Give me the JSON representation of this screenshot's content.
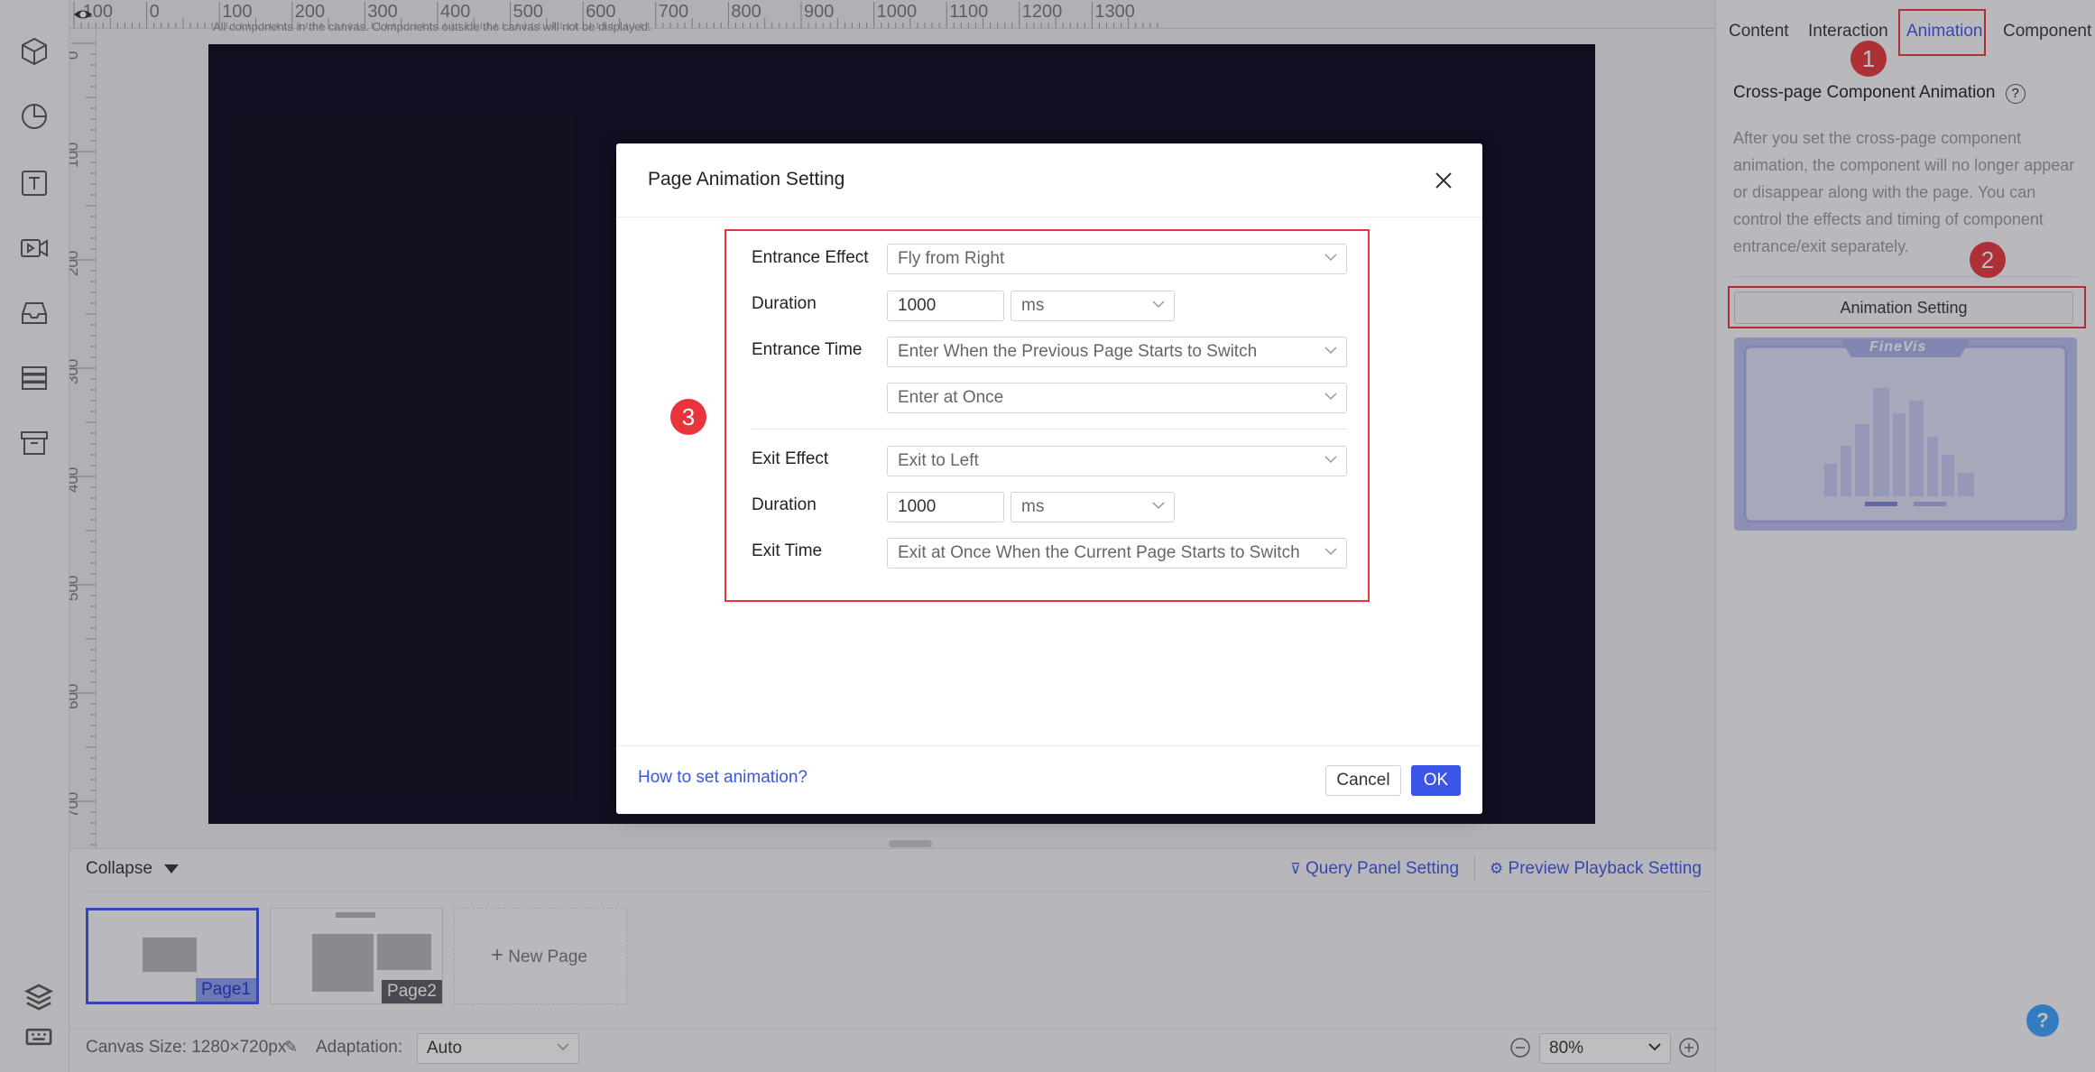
{
  "ruler": {
    "top_ticks": [
      "-100",
      "0",
      "100",
      "200",
      "300",
      "400",
      "500",
      "600",
      "700",
      "800",
      "900",
      "1000",
      "1100",
      "1200",
      "1300"
    ],
    "left_ticks": [
      "0",
      "100",
      "200",
      "300",
      "400",
      "500",
      "600",
      "700"
    ]
  },
  "canvas": {
    "hint": "All components in the canvas. Components outside the canvas will not be displayed.",
    "background": "#07051a"
  },
  "left_toolbar": {
    "icons": [
      "cube-icon",
      "pie-chart-icon",
      "text-icon",
      "video-icon",
      "inbox-icon",
      "list-icon",
      "archive-icon",
      "layers-icon",
      "keyboard-icon"
    ]
  },
  "page_strip": {
    "collapse_label": "Collapse",
    "query_panel_label": "Query Panel Setting",
    "preview_playback_label": "Preview Playback Setting",
    "pages": [
      {
        "label": "Page1",
        "active": true
      },
      {
        "label": "Page2",
        "active": false
      }
    ],
    "new_page_label": "New Page"
  },
  "bottom_bar": {
    "canvas_size_label": "Canvas Size: 1280×720px",
    "adaptation_label": "Adaptation:",
    "adaptation_value": "Auto",
    "zoom_value": "80%"
  },
  "right_panel": {
    "tabs": [
      {
        "label": "Content",
        "active": false
      },
      {
        "label": "Interaction",
        "active": false
      },
      {
        "label": "Animation",
        "active": true
      },
      {
        "label": "Component",
        "active": false
      }
    ],
    "heading": "Cross-page Component Animation",
    "description": "After you set the cross-page component animation, the component will no longer appear or disappear along with the page. You can control the effects and timing of component entrance/exit separately.",
    "animation_button_label": "Animation Setting",
    "preview_logo": "FineVis",
    "help_label": "?"
  },
  "annotations": {
    "badge1": "1",
    "badge2": "2",
    "badge3": "3"
  },
  "modal": {
    "title": "Page Animation Setting",
    "entrance_effect_label": "Entrance Effect",
    "entrance_effect_value": "Fly from Right",
    "entrance_duration_label": "Duration",
    "entrance_duration_value": "1000",
    "entrance_duration_unit": "ms",
    "entrance_time_label": "Entrance Time",
    "entrance_time_value": "Enter When the Previous Page Starts to Switch",
    "entrance_time_mode": "Enter at Once",
    "exit_effect_label": "Exit Effect",
    "exit_effect_value": "Exit to Left",
    "exit_duration_label": "Duration",
    "exit_duration_value": "1000",
    "exit_duration_unit": "ms",
    "exit_time_label": "Exit Time",
    "exit_time_value": "Exit at Once When the Current Page Starts to Switch",
    "help_link": "How to set animation?",
    "cancel_label": "Cancel",
    "ok_label": "OK"
  },
  "colors": {
    "accent": "#3b55e6",
    "annotation_red": "#e8343a",
    "help_blue": "#3aa1ff"
  }
}
